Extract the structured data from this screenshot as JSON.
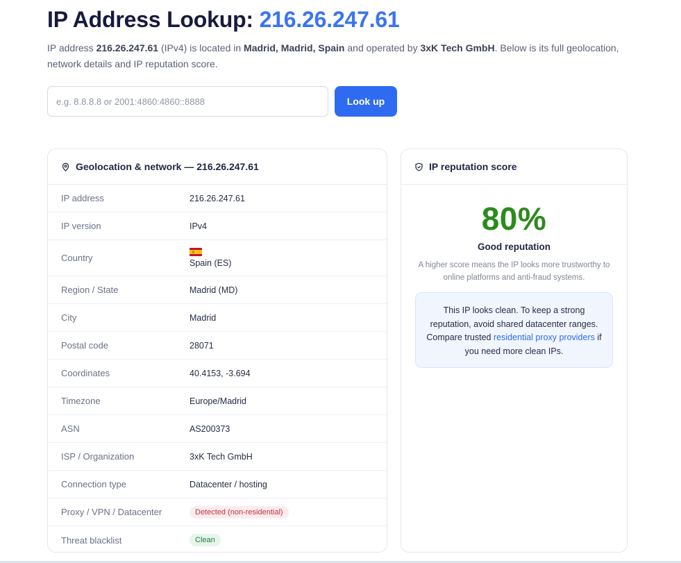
{
  "header": {
    "title_prefix": "IP Address Lookup: ",
    "title_ip": "216.26.247.61",
    "intro": {
      "p1": "IP address ",
      "ip": "216.26.247.61",
      "p2": " (IPv4) is located in ",
      "location": "Madrid, Madrid, Spain",
      "p3": " and operated by ",
      "org": "3xK Tech GmbH",
      "p4": ". Below is its full geolocation, network details and IP reputation score."
    }
  },
  "search": {
    "value": "",
    "placeholder": "e.g. 8.8.8.8 or 2001:4860:4860::8888",
    "button_label": "Look up"
  },
  "geo": {
    "title": "Geolocation & network — 216.26.247.61",
    "icon": "location-pin-icon",
    "rows": [
      {
        "label": "IP address",
        "value": "216.26.247.61"
      },
      {
        "label": "IP version",
        "value": "IPv4"
      },
      {
        "label": "Country",
        "value": "Spain (ES)"
      },
      {
        "label": "Region / State",
        "value": "Madrid (MD)"
      },
      {
        "label": "City",
        "value": "Madrid"
      },
      {
        "label": "Postal code",
        "value": "28071"
      },
      {
        "label": "Coordinates",
        "value": "40.4153, -3.694"
      },
      {
        "label": "Timezone",
        "value": "Europe/Madrid"
      },
      {
        "label": "ASN",
        "value": "AS200373"
      },
      {
        "label": "ISP / Organization",
        "value": "3xK Tech GmbH"
      },
      {
        "label": "Connection type",
        "value": "Datacenter / hosting"
      },
      {
        "label": "Proxy / VPN / Datacenter",
        "value": "Detected (non-residential)"
      },
      {
        "label": "Threat blacklist",
        "value": "Clean"
      }
    ]
  },
  "reputation": {
    "title": "IP reputation score",
    "icon": "shield-check-icon",
    "score": "80%",
    "label": "Good reputation",
    "description": "A higher score means the IP looks more trustworthy to online platforms and anti-fraud systems.",
    "notice": {
      "text1": "This IP looks clean. To keep a strong reputation, avoid shared datacenter ranges. Compare trusted ",
      "link": "residential proxy providers",
      "text2": " if you need more clean IPs."
    }
  },
  "colors": {
    "accent": "#2f6bf0",
    "title_ip": "#3b74ef",
    "score": "#2c8a1d",
    "danger_badge": "#c0303d",
    "clean_badge": "#1f7a3a"
  }
}
